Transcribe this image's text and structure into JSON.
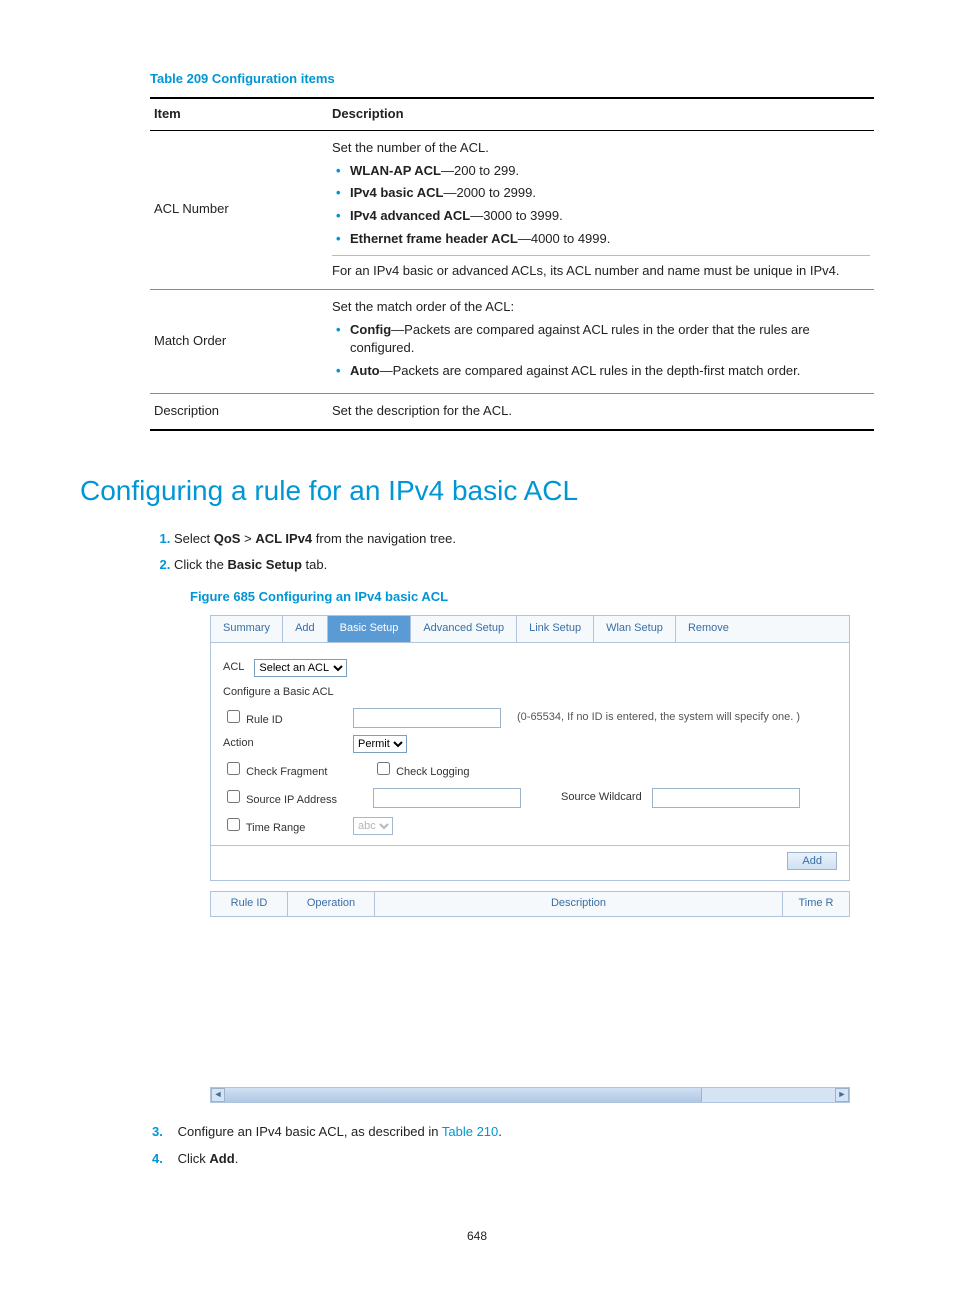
{
  "tableCaption": "Table 209 Configuration items",
  "tableHeaders": {
    "item": "Item",
    "desc": "Description"
  },
  "rows": {
    "aclNumber": {
      "item": "ACL Number",
      "intro": "Set the number of the ACL.",
      "b1_bold": "WLAN-AP ACL",
      "b1_rest": "—200 to 299.",
      "b2_bold": "IPv4 basic ACL",
      "b2_rest": "—2000 to 2999.",
      "b3_bold": "IPv4 advanced ACL",
      "b3_rest": "—3000 to 3999.",
      "b4_bold": "Ethernet frame header ACL",
      "b4_rest": "—4000 to 4999.",
      "note": "For an IPv4 basic or advanced ACLs, its ACL number and name must be unique in IPv4."
    },
    "matchOrder": {
      "item": "Match Order",
      "intro": "Set the match order of the ACL:",
      "b1_bold": "Config",
      "b1_rest": "—Packets are compared against ACL rules in the order that the rules are configured.",
      "b2_bold": "Auto",
      "b2_rest": "—Packets are compared against ACL rules in the depth-first match order."
    },
    "description": {
      "item": "Description",
      "text": "Set the description for the ACL."
    }
  },
  "sectionTitle": "Configuring a rule for an IPv4 basic ACL",
  "steps1": {
    "s1_a": "Select ",
    "s1_b": "QoS",
    "s1_c": " > ",
    "s1_d": "ACL IPv4",
    "s1_e": " from the navigation tree.",
    "s2_a": "Click the ",
    "s2_b": "Basic Setup",
    "s2_c": " tab."
  },
  "figureCaption": "Figure 685 Configuring an IPv4 basic ACL",
  "figure": {
    "tabs": {
      "summary": "Summary",
      "add": "Add",
      "basic": "Basic Setup",
      "advanced": "Advanced Setup",
      "link": "Link Setup",
      "wlan": "Wlan Setup",
      "remove": "Remove"
    },
    "aclLabel": "ACL",
    "aclSelect": "Select an ACL",
    "configLabel": "Configure a Basic ACL",
    "ruleIdLabel": "Rule ID",
    "ruleHint": "(0-65534, If no ID is entered, the system will specify one. )",
    "actionLabel": "Action",
    "actionSelect": "Permit",
    "checkFragment": "Check Fragment",
    "checkLogging": "Check Logging",
    "sourceIp": "Source IP Address",
    "sourceWildcard": "Source Wildcard",
    "timeRange": "Time Range",
    "timeSelect": "abc",
    "addBtn": "Add",
    "rulesHeaders": {
      "ruleId": "Rule ID",
      "operation": "Operation",
      "description": "Description",
      "timer": "Time R"
    }
  },
  "steps2": {
    "s3_a": "Configure an IPv4 basic ACL, as described in ",
    "s3_link": "Table 210",
    "s3_b": ".",
    "s4_a": "Click ",
    "s4_b": "Add",
    "s4_c": "."
  },
  "pageNumber": "648"
}
